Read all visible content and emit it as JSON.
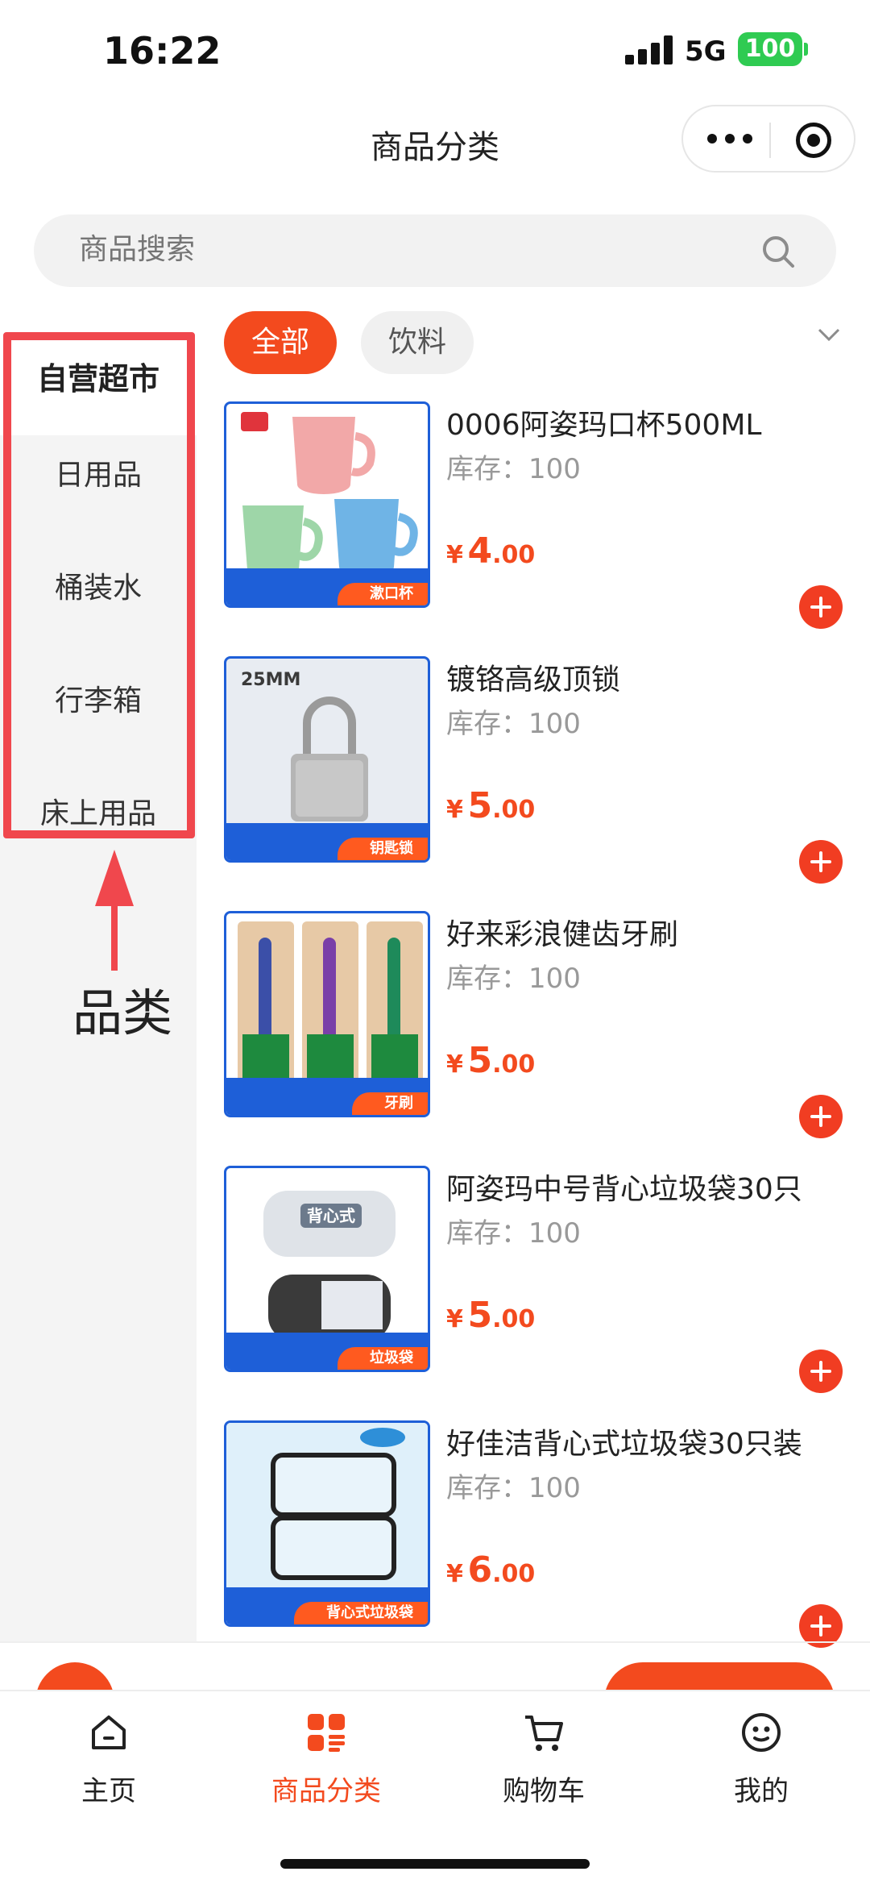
{
  "status_bar": {
    "time": "16:22",
    "network": "5G",
    "battery": "100"
  },
  "nav": {
    "title": "商品分类"
  },
  "search": {
    "placeholder": "商品搜索"
  },
  "sidebar": {
    "items": [
      {
        "label": "自营超市",
        "active": true
      },
      {
        "label": "日用品",
        "active": false
      },
      {
        "label": "桶装水",
        "active": false
      },
      {
        "label": "行李箱",
        "active": false
      },
      {
        "label": "床上用品",
        "active": false
      }
    ]
  },
  "annotation": {
    "label": "品类"
  },
  "chips": [
    {
      "label": "全部",
      "active": true
    },
    {
      "label": "饮料",
      "active": false
    }
  ],
  "products": [
    {
      "name": "0006阿姿玛口杯500ML",
      "stock": "库存：100",
      "currency": "¥",
      "price_int": "4",
      "price_dec": ".00",
      "tag": "漱口杯"
    },
    {
      "name": "镀铬高级顶锁",
      "stock": "库存：100",
      "currency": "¥",
      "price_int": "5",
      "price_dec": ".00",
      "tag": "钥匙锁",
      "image_text": "25MM"
    },
    {
      "name": "好来彩浪健齿牙刷",
      "stock": "库存：100",
      "currency": "¥",
      "price_int": "5",
      "price_dec": ".00",
      "tag": "牙刷"
    },
    {
      "name": "阿姿玛中号背心垃圾袋30只",
      "stock": "库存：100",
      "currency": "¥",
      "price_int": "5",
      "price_dec": ".00",
      "tag": "垃圾袋",
      "image_text": "背心式"
    },
    {
      "name": "好佳洁背心式垃圾袋30只装",
      "stock": "库存：100",
      "currency": "¥",
      "price_int": "6",
      "price_dec": ".00",
      "tag": "背心式垃圾袋"
    }
  ],
  "tabbar": {
    "items": [
      {
        "label": "主页",
        "icon": "home-icon"
      },
      {
        "label": "商品分类",
        "icon": "category-icon",
        "active": true
      },
      {
        "label": "购物车",
        "icon": "cart-icon"
      },
      {
        "label": "我的",
        "icon": "profile-icon"
      }
    ]
  },
  "colors": {
    "accent": "#f34a1e",
    "highlight": "#f0474d",
    "thumb_border": "#1e5fd8"
  }
}
